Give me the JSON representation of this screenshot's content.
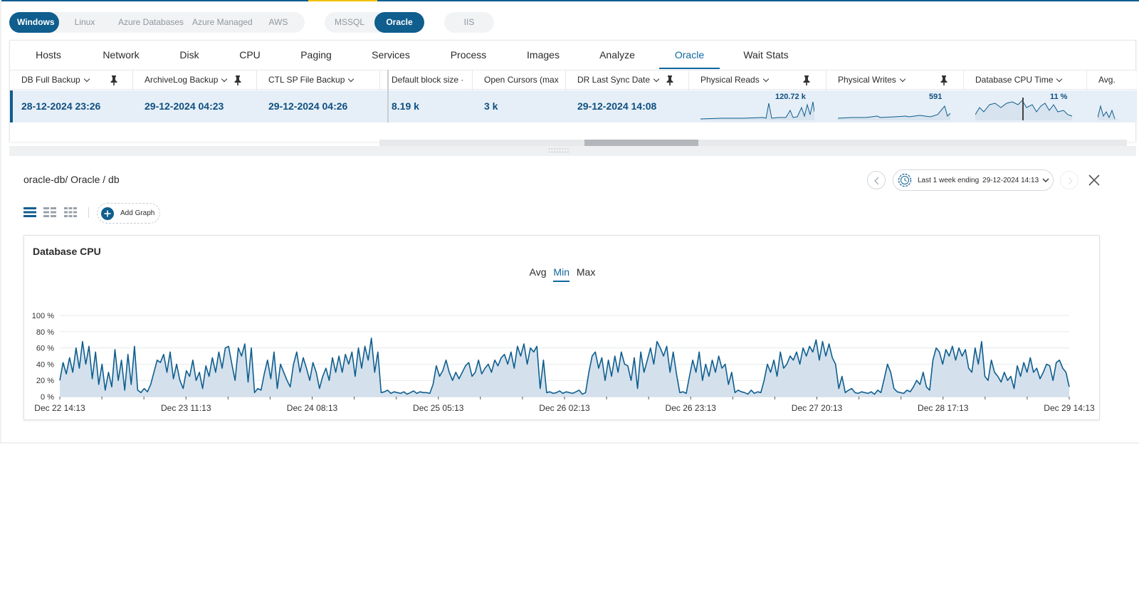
{
  "platform_tabs": [
    {
      "label": "Windows",
      "active": true
    },
    {
      "label": "Linux",
      "active": false
    },
    {
      "label": "Azure Databases",
      "active": false
    },
    {
      "label": "Azure Managed",
      "active": false
    },
    {
      "label": "AWS",
      "active": false
    }
  ],
  "db_tabs": [
    {
      "label": "MSSQL",
      "active": false
    },
    {
      "label": "Oracle",
      "active": true
    }
  ],
  "web_tabs": [
    {
      "label": "IIS",
      "active": false
    }
  ],
  "main_tabs": [
    {
      "label": "Hosts",
      "active": false
    },
    {
      "label": "Network",
      "active": false
    },
    {
      "label": "Disk",
      "active": false
    },
    {
      "label": "CPU",
      "active": false
    },
    {
      "label": "Paging",
      "active": false
    },
    {
      "label": "Services",
      "active": false
    },
    {
      "label": "Process",
      "active": false
    },
    {
      "label": "Images",
      "active": false
    },
    {
      "label": "Analyze",
      "active": false
    },
    {
      "label": "Oracle",
      "active": true
    },
    {
      "label": "Wait Stats",
      "active": false
    }
  ],
  "grid": {
    "columns": [
      {
        "label": "DB Full Backup",
        "pinned": true
      },
      {
        "label": "ArchiveLog Backup",
        "pinned": true
      },
      {
        "label": "CTL SP File Backup",
        "pinned": false
      },
      {
        "label": "Default block size",
        "pinned": false
      },
      {
        "label": "Open Cursors (max",
        "pinned": false
      },
      {
        "label": "DR Last Sync Date",
        "pinned": true
      },
      {
        "label": "Physical Reads",
        "pinned": true
      },
      {
        "label": "Physical Writes",
        "pinned": true
      },
      {
        "label": "Database CPU Time",
        "pinned": false
      },
      {
        "label": "Avg.",
        "pinned": false
      }
    ],
    "row": {
      "db_full_backup": "28-12-2024 23:26",
      "archivelog_backup": "29-12-2024 04:23",
      "ctl_sp_file_backup": "29-12-2024 04:26",
      "default_block_size": "8.19 k",
      "open_cursors": "3 k",
      "dr_last_sync_date": "29-12-2024 14:08",
      "physical_reads_label": "120.72 k",
      "physical_writes_label": "591",
      "database_cpu_time_label": "11 %"
    }
  },
  "detail": {
    "breadcrumb": "oracle-db/ Oracle / db",
    "time_range": "Last 1 week ending",
    "time_end": "29-12-2024 14:13",
    "add_graph_label": "Add Graph"
  },
  "chart": {
    "title": "Database CPU",
    "stat_tabs": [
      {
        "label": "Avg",
        "active": false
      },
      {
        "label": "Min",
        "active": true
      },
      {
        "label": "Max",
        "active": false
      }
    ]
  },
  "colors": {
    "brand": "#0f5e8e",
    "accent_tab": "#0f67a0",
    "row_highlight": "#e6eff7",
    "series_line": "#0f5e8e",
    "series_fill": "#cfdeeb",
    "top_accent": "#f2c200"
  },
  "icons": {
    "pin": "pin-icon",
    "caret": "chevron-down-icon",
    "clock": "clock-icon",
    "prev": "chevron-left-icon",
    "next": "chevron-right-icon",
    "close": "close-icon",
    "add": "plus-icon",
    "layout_list": "layout-list-icon",
    "layout_grid2": "layout-grid-2-icon",
    "layout_grid3": "layout-grid-3-icon"
  },
  "chart_data": {
    "type": "area",
    "title": "Database CPU",
    "xlabel": "",
    "ylabel": "",
    "ylim": [
      0,
      100
    ],
    "y_ticks": [
      "0 %",
      "20 %",
      "40 %",
      "60 %",
      "80 %",
      "100 %"
    ],
    "x_ticks": [
      "Dec 22 14:13",
      "Dec 23 11:13",
      "Dec 24 08:13",
      "Dec 25 05:13",
      "Dec 26 02:13",
      "Dec 26 23:13",
      "Dec 27 20:13",
      "Dec 28 17:13",
      "Dec 29 14:13"
    ],
    "x_range_hours": [
      0,
      168
    ],
    "grid": true,
    "series": [
      {
        "values": [
          20,
          42,
          28,
          48,
          30,
          60,
          35,
          68,
          40,
          62,
          22,
          55,
          15,
          40,
          8,
          30,
          12,
          58,
          20,
          45,
          8,
          52,
          15,
          62,
          8,
          5,
          10,
          6,
          15,
          30,
          45,
          42,
          52,
          30,
          55,
          22,
          40,
          20,
          10,
          32,
          25,
          45,
          20,
          30,
          10,
          38,
          25,
          48,
          30,
          55,
          35,
          60,
          62,
          40,
          20,
          60,
          50,
          65,
          18,
          60,
          5,
          10,
          8,
          28,
          45,
          22,
          55,
          10,
          40,
          30,
          20,
          12,
          40,
          55,
          30,
          48,
          35,
          20,
          42,
          30,
          10,
          25,
          35,
          20,
          48,
          30,
          50,
          30,
          52,
          40,
          55,
          25,
          60,
          35,
          62,
          45,
          72,
          30,
          55,
          5,
          6,
          8,
          4,
          6,
          5,
          4,
          6,
          3,
          5,
          7,
          4,
          6,
          5,
          5,
          4,
          15,
          38,
          25,
          32,
          45,
          30,
          20,
          30,
          22,
          30,
          38,
          42,
          25,
          30,
          45,
          28,
          35,
          40,
          30,
          45,
          38,
          48,
          52,
          40,
          55,
          35,
          62,
          50,
          65,
          40,
          60,
          55,
          62,
          10,
          45,
          5,
          6,
          4,
          5,
          7,
          4,
          6,
          5,
          4,
          6,
          8,
          3,
          5,
          30,
          50,
          55,
          35,
          48,
          20,
          45,
          25,
          50,
          30,
          55,
          40,
          38,
          20,
          48,
          10,
          55,
          30,
          45,
          60,
          40,
          68,
          60,
          50,
          62,
          30,
          55,
          28,
          5,
          6,
          4,
          25,
          45,
          30,
          55,
          20,
          40,
          25,
          45,
          30,
          50,
          35,
          40,
          15,
          30,
          5,
          8,
          6,
          5,
          3,
          8,
          4,
          6,
          5,
          20,
          40,
          30,
          45,
          25,
          55,
          35,
          40,
          50,
          45,
          55,
          40,
          60,
          50,
          62,
          55,
          70,
          45,
          68,
          50,
          65,
          48,
          40,
          10,
          25,
          5,
          8,
          10,
          5,
          4,
          6,
          5,
          4,
          6,
          3,
          8,
          5,
          22,
          40,
          30,
          10,
          6,
          5,
          4,
          8,
          6,
          12,
          20,
          15,
          30,
          12,
          8,
          45,
          60,
          55,
          40,
          58,
          50,
          62,
          45,
          60,
          50,
          58,
          35,
          30,
          60,
          40,
          68,
          25,
          20,
          45,
          30,
          25,
          18,
          30,
          20,
          25,
          10,
          38,
          25,
          42,
          30,
          48,
          30,
          35,
          22,
          30,
          40,
          38,
          20,
          42,
          45,
          35,
          30,
          12
        ]
      }
    ]
  }
}
